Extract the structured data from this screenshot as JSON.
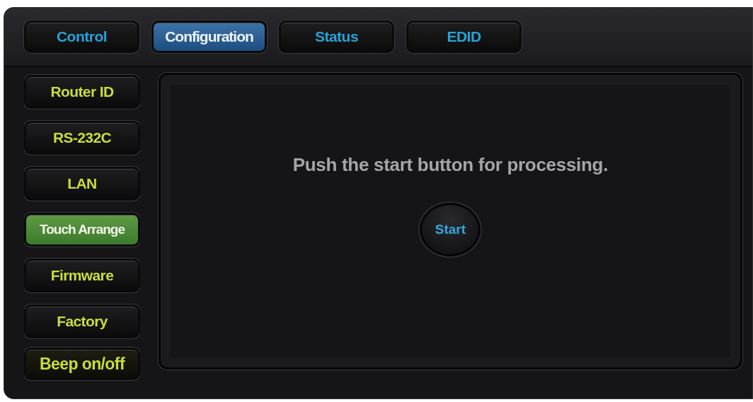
{
  "tabs": [
    {
      "label": "Control",
      "selected": false
    },
    {
      "label": "Configuration",
      "selected": true
    },
    {
      "label": "Status",
      "selected": false
    },
    {
      "label": "EDID",
      "selected": false
    }
  ],
  "sidebar": {
    "items": [
      {
        "label": "Router ID",
        "selected": false
      },
      {
        "label": "RS-232C",
        "selected": false
      },
      {
        "label": "LAN",
        "selected": false
      },
      {
        "label": "Touch Arrange",
        "selected": true
      },
      {
        "label": "Firmware",
        "selected": false
      },
      {
        "label": "Factory",
        "selected": false
      },
      {
        "label": "Beep on/off",
        "selected": false
      }
    ]
  },
  "content": {
    "message": "Push the start button for processing.",
    "start_button": "Start"
  }
}
